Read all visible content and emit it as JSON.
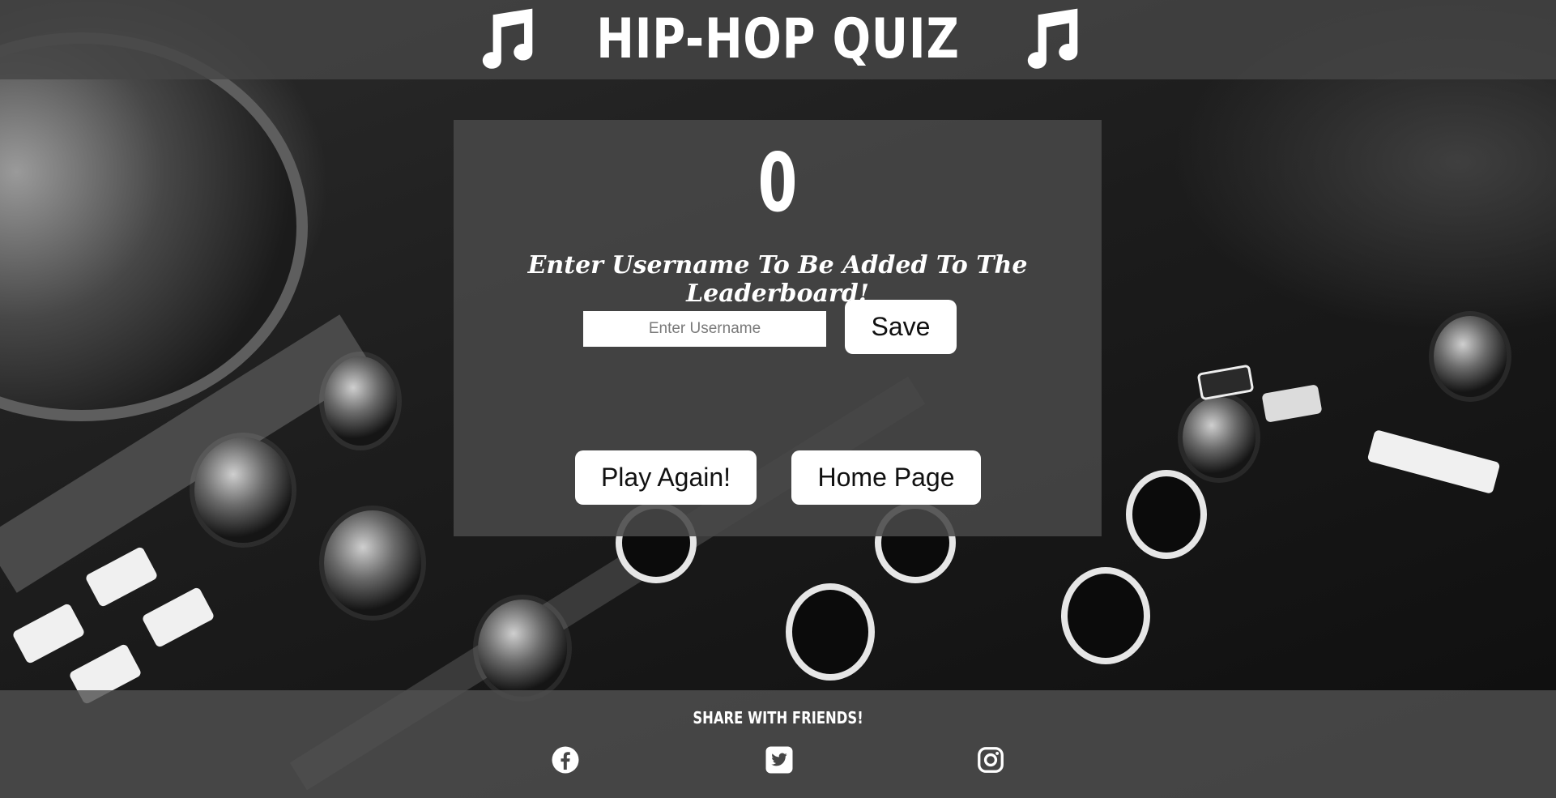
{
  "header": {
    "title": "HIP-HOP QUIZ",
    "left_icon": "music-note-icon",
    "right_icon": "music-note-icon"
  },
  "result": {
    "score": "0",
    "prompt": "Enter Username To Be Added To The Leaderboard!",
    "username_placeholder": "Enter Username",
    "username_value": "",
    "save_label": "Save",
    "play_again_label": "Play Again!",
    "home_label": "Home Page"
  },
  "footer": {
    "share_label": "SHARE WITH FRIENDS!",
    "social_icons": [
      "facebook-icon",
      "twitter-icon",
      "instagram-icon"
    ]
  },
  "colors": {
    "header_bg": "#464646",
    "card_bg": "#484848",
    "button_bg": "#ffffff",
    "text": "#ffffff"
  }
}
